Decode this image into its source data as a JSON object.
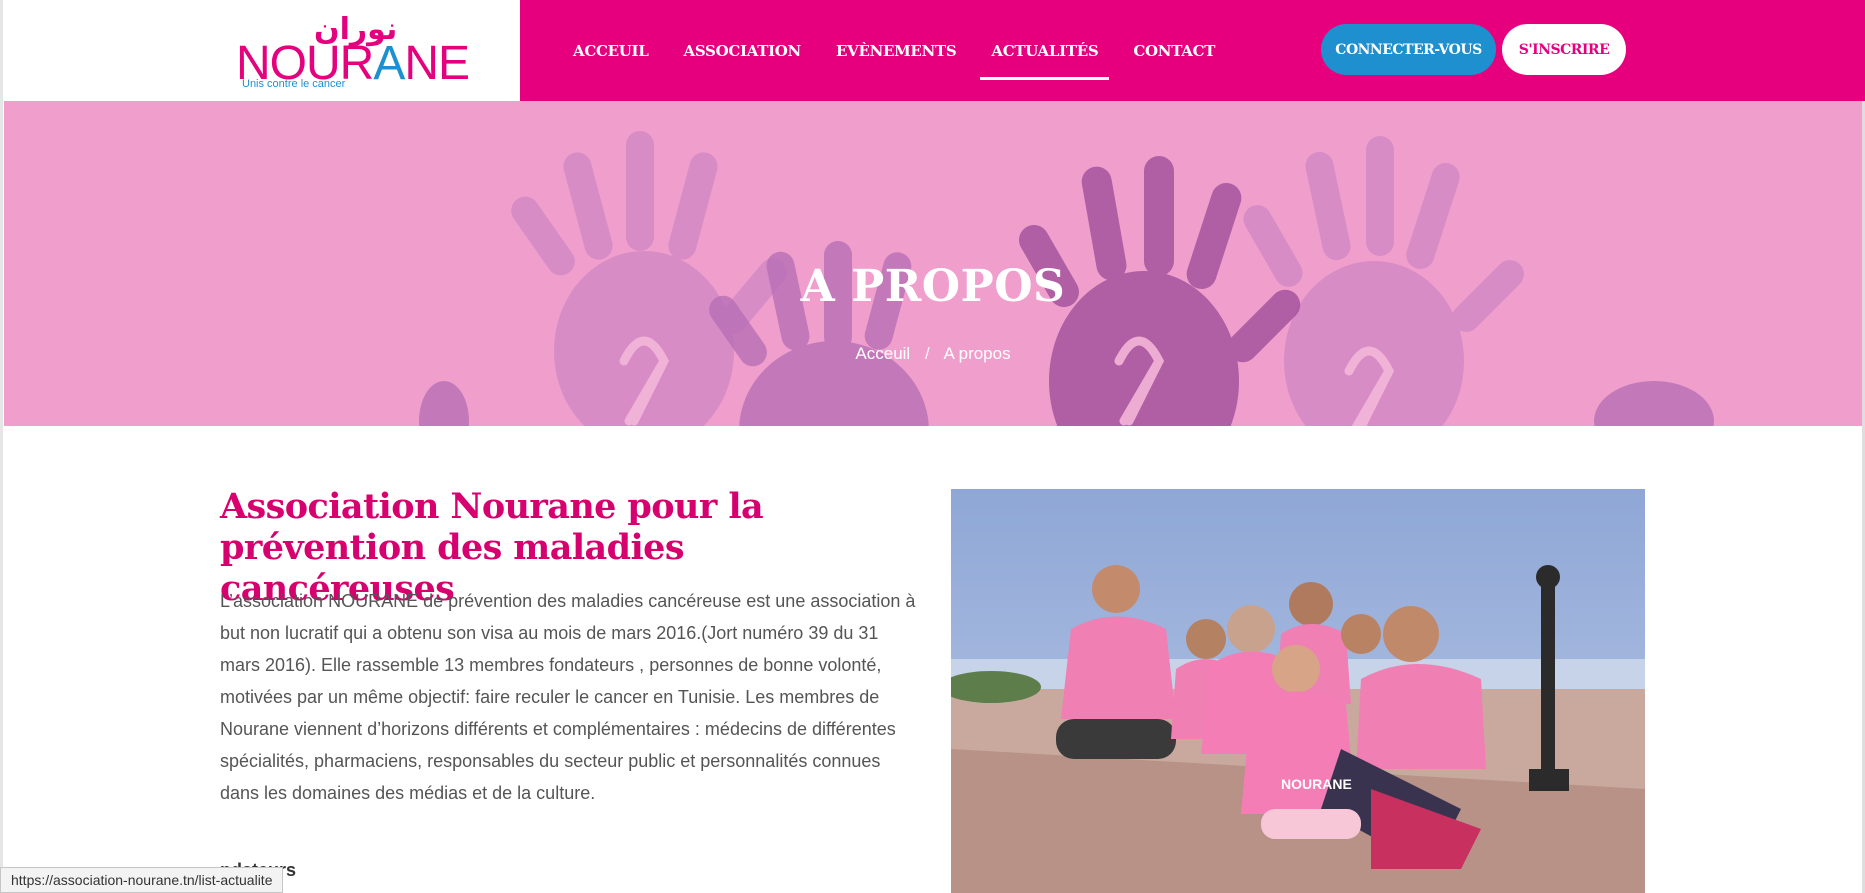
{
  "logo": {
    "arabic": "نوران",
    "word_part1": "NOUR",
    "word_part2": "A",
    "word_part3": "NE",
    "tagline": "Unis contre le cancer"
  },
  "nav": {
    "items": [
      {
        "label": "ACCEUIL"
      },
      {
        "label": "ASSOCIATION"
      },
      {
        "label": "EVÈNEMENTS"
      },
      {
        "label": "ACTUALITÉS",
        "active": true
      },
      {
        "label": "CONTACT"
      }
    ],
    "login_label": "CONNECTER-VOUS",
    "signup_label": "S'INSCRIRE"
  },
  "hero": {
    "title": "A PROPOS",
    "breadcrumb": {
      "home": "Acceuil",
      "separator": "/",
      "current": "A propos"
    }
  },
  "content": {
    "title": "Association Nourane pour la prévention des maladies cancéreuses",
    "body": "L’association NOURANE de prévention des maladies cancéreuse est une association à but non lucratif qui a obtenu son visa au mois de mars 2016.(Jort numéro 39 du 31 mars 2016). Elle rassemble 13 membres fondateurs , personnes de bonne volonté, motivées par un même objectif: faire reculer le cancer en Tunisie. Les membres de Nourane viennent d’horizons différents et complémentaires : médecins de différentes spécialités, pharmaciens, responsables du secteur public et personnalités connues dans les domaines des médias et de la culture.",
    "subheading": "ndateurs",
    "photo_shirt_text": "NOURANE"
  },
  "status_bar": {
    "url": "https://association-nourane.tn/list-actualite"
  },
  "colors": {
    "brand_pink": "#e6007e",
    "hero_pink": "#f09fcc",
    "accent_blue": "#1e90cf",
    "title_pink": "#d6006f"
  }
}
